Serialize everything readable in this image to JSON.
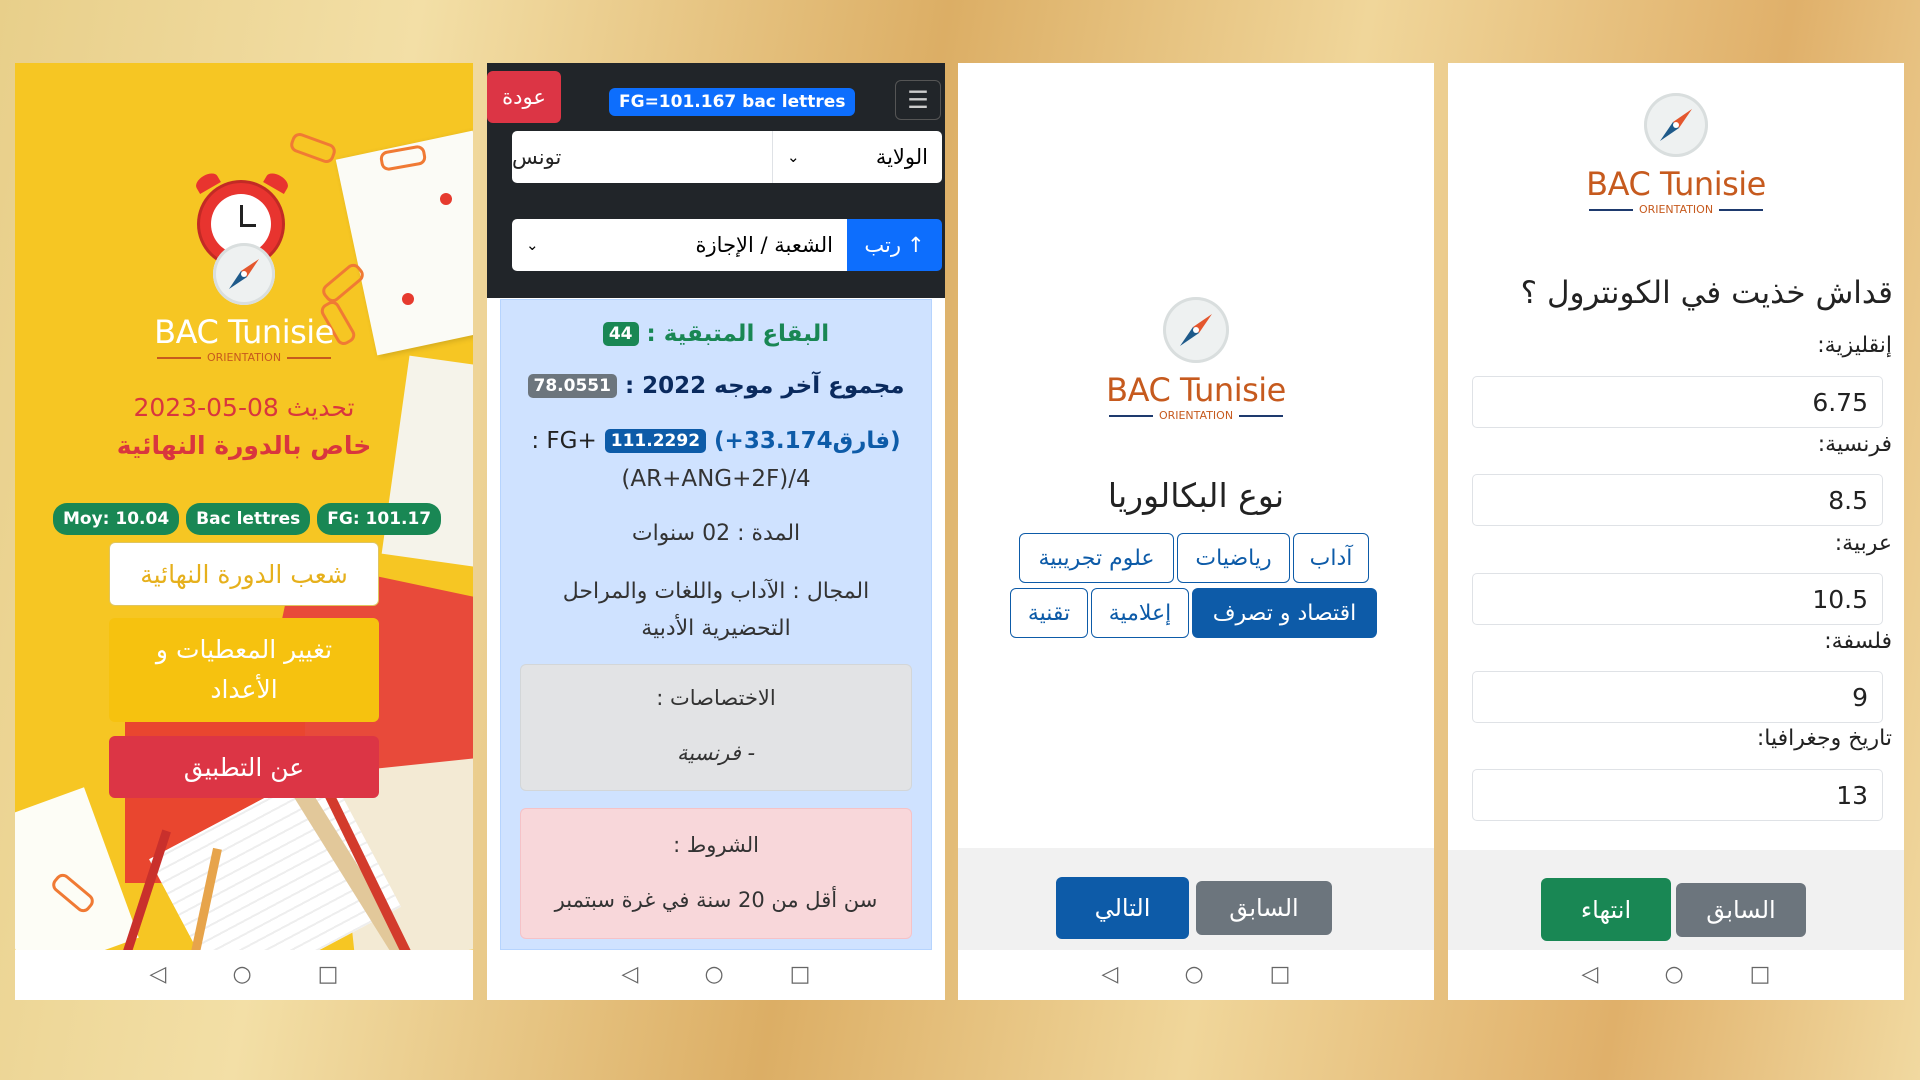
{
  "screen1": {
    "logo": {
      "brand": "BAC Tunisie",
      "sub": "ORIENTATION"
    },
    "update_text": "تحديث 08-05-2023",
    "final_session": "خاص بالدورة النهائية",
    "badges": {
      "moy": "Moy: 10.04",
      "bac": "Bac lettres",
      "fg": "FG: 101.17"
    },
    "btn_branches": "شعب الدورة النهائية",
    "btn_change": "تغيير المعطيات و الأعداد",
    "btn_about": "عن التطبيق"
  },
  "screen2": {
    "back_label": "عودة",
    "fg_badge": "FG=101.167 bac lettres",
    "city_value": "تونس",
    "wilaya_select": "الولاية",
    "branch_select": "الشعبة / الإجازة",
    "sort_label": "رتب",
    "remaining_label": "البقاع المتبقية :",
    "remaining_value": "44",
    "last_total_label": "مجموع آخر موجه 2022 :",
    "last_total_value": "78.0551",
    "diff_text": "(فارق33.174+)",
    "fg_plus_value": "111.2292",
    "fg_plus_label": ": FG+",
    "formula": "(AR+ANG+2F)/4",
    "duration": "المدة : 02 سنوات",
    "domain": "المجال : الآداب واللغات والمراحل التحضيرية الأدبية",
    "specialties_label": "الاختصاصات :",
    "specialties_value": "- فرنسية",
    "conditions_label": "الشروط :",
    "conditions_value": "سن أقل من 20 سنة في غرة سبتمبر"
  },
  "screen3": {
    "logo": {
      "brand": "BAC Tunisie",
      "sub": "ORIENTATION"
    },
    "title": "نوع البكالوريا",
    "options_row1": [
      "آداب",
      "رياضيات",
      "علوم تجريبية"
    ],
    "options_row2": [
      "اقتصاد و تصرف",
      "إعلامية",
      "تقنية"
    ],
    "selected": "اقتصاد و تصرف",
    "btn_next": "التالي",
    "btn_prev": "السابق"
  },
  "screen4": {
    "logo": {
      "brand": "BAC Tunisie",
      "sub": "ORIENTATION"
    },
    "question": "قداش خذيت في الكونترول ؟",
    "fields": [
      {
        "label": "إنقليزية:",
        "value": "6.75"
      },
      {
        "label": "فرنسية:",
        "value": "8.5"
      },
      {
        "label": "عربية:",
        "value": "10.5"
      },
      {
        "label": "فلسفة:",
        "value": "9"
      },
      {
        "label": "تاريخ وجغرافيا:",
        "value": "13"
      }
    ],
    "btn_finish": "انتهاء",
    "btn_prev": "السابق"
  },
  "nav": {
    "back": "◁",
    "home": "○",
    "recent": "□"
  },
  "colors": {
    "green": "#198754",
    "blue": "#0d5ba8",
    "red": "#dc3545",
    "yellow": "#f7c318",
    "gray": "#6c757d",
    "brand_orange": "#c65a1e"
  }
}
